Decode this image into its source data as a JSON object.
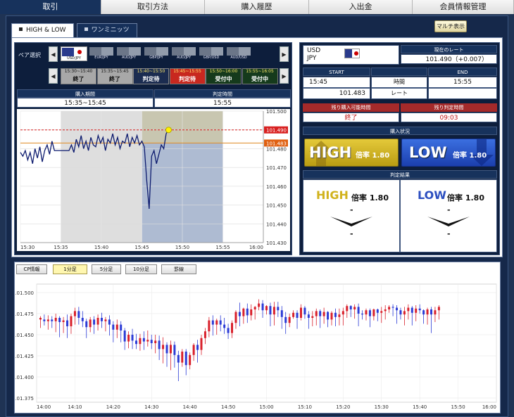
{
  "nav": {
    "tabs": [
      {
        "label": "取引",
        "active": true
      },
      {
        "label": "取引方法",
        "active": false
      },
      {
        "label": "購入履歴",
        "active": false
      },
      {
        "label": "入出金",
        "active": false
      },
      {
        "label": "会員情報管理",
        "active": false
      }
    ]
  },
  "subtabs": [
    {
      "label": "HIGH & LOW",
      "active": true
    },
    {
      "label": "ワンミニッツ",
      "active": false
    }
  ],
  "multi_button": "マルチ表示",
  "pair": {
    "label": "ペア選択",
    "items": [
      {
        "name": "USD/JPY",
        "selected": true
      },
      {
        "name": "EUR/JPY",
        "selected": false
      },
      {
        "name": "AUD/JPY",
        "selected": false
      },
      {
        "name": "GBP/JPY",
        "selected": false
      },
      {
        "name": "AUD/JPY",
        "selected": false
      },
      {
        "name": "GBP/USD",
        "selected": false
      },
      {
        "name": "AUD/USD",
        "selected": false
      }
    ]
  },
  "periods": [
    {
      "time": "15:30~15:40",
      "status": "終了",
      "state": "done"
    },
    {
      "time": "15:35~15:45",
      "status": "終了",
      "state": "done"
    },
    {
      "time": "15:40~15:50",
      "status": "判定待",
      "state": "wait"
    },
    {
      "time": "15:45~15:55",
      "status": "判定待",
      "state": "red"
    },
    {
      "time": "15:50~16:00",
      "status": "受付中",
      "state": "open"
    },
    {
      "time": "15:55~16:05",
      "status": "受付中",
      "state": "open"
    }
  ],
  "purchase_period": {
    "label": "購入期間",
    "value": "15:35~15:45"
  },
  "judgment_time": {
    "label": "判定時間",
    "value": "15:55"
  },
  "live_chart": {
    "current_rate_label": "101.490",
    "target_rate_label": "101.483",
    "yticks": [
      "101.500",
      "101.490",
      "101.480",
      "101.470",
      "101.460",
      "101.450",
      "101.440",
      "101.430"
    ],
    "xticks": [
      "15:30",
      "15:35",
      "15:40",
      "15:45",
      "15:50",
      "15:55",
      "16:00"
    ]
  },
  "chart_data": {
    "type": "line",
    "ylim": [
      101.43,
      101.5
    ],
    "xlim": [
      "15:30",
      "16:00"
    ],
    "purchase_window": [
      "15:35",
      "15:45"
    ],
    "judgment_window": [
      "15:45",
      "15:55"
    ],
    "target_rate": 101.483,
    "current_rate": 101.49,
    "x": [
      0,
      0.3,
      0.6,
      0.9,
      1.2,
      1.5,
      1.8,
      2.1,
      2.4,
      2.7,
      3.0,
      3.3,
      3.6,
      3.9,
      4.2,
      4.5,
      4.8,
      5.1,
      5.4,
      5.7,
      6.0,
      6.3,
      6.6,
      6.9,
      7.2,
      7.5,
      7.8,
      8.1,
      8.4,
      8.7,
      9.0,
      9.3,
      9.6,
      9.9,
      10.2,
      10.5,
      10.8,
      11.1,
      11.4,
      11.7,
      12.0,
      12.3,
      12.6,
      12.9,
      13.2,
      13.5,
      13.8,
      14.1,
      14.4,
      14.7,
      15.0,
      15.3,
      15.6,
      15.9,
      16.2,
      16.5,
      16.8,
      17.1,
      17.4,
      17.7,
      18.0,
      18.3
    ],
    "y": [
      101.478,
      101.476,
      101.479,
      101.474,
      101.478,
      101.472,
      101.48,
      101.475,
      101.481,
      101.473,
      101.479,
      101.482,
      101.477,
      101.484,
      101.479,
      101.479,
      101.479,
      101.479,
      101.479,
      101.479,
      101.479,
      101.482,
      101.478,
      101.485,
      101.481,
      101.487,
      101.48,
      101.484,
      101.479,
      101.486,
      101.482,
      101.481,
      101.487,
      101.483,
      101.486,
      101.479,
      101.485,
      101.483,
      101.488,
      101.482,
      101.486,
      101.48,
      101.484,
      101.483,
      101.488,
      101.481,
      101.486,
      101.483,
      101.487,
      101.482,
      101.484,
      101.481,
      101.463,
      101.448,
      101.476,
      101.479,
      101.472,
      101.477,
      101.482,
      101.48,
      101.488,
      101.49
    ]
  },
  "right": {
    "currency_top": "USD",
    "currency_bottom": "JPY",
    "current_rate_label": "現在のレート",
    "current_rate_value": "101.490（+0.007）",
    "start_label": "START",
    "end_label": "END",
    "start_value": "15:45",
    "time_label": "時間",
    "end_value": "15:55",
    "start_rate": "101.483",
    "rate_label": "レート",
    "remaining_buy_label": "残り購入可能時間",
    "remaining_buy_value": "終了",
    "remaining_judge_label": "残り判定時間",
    "remaining_judge_value": "09:03",
    "purchase_status_label": "購入状況",
    "high_label": "HIGH",
    "low_label": "LOW",
    "payout_text": "倍率 1.80",
    "result_label": "判定結果",
    "result_high": "HIGH",
    "result_low": "LOW",
    "dash": "-"
  },
  "candle_tabs": [
    {
      "label": "CP情報",
      "active": false
    },
    {
      "label": "1分足",
      "active": true
    },
    {
      "label": "5分足",
      "active": false
    },
    {
      "label": "10分足",
      "active": false
    },
    {
      "label": "罫線",
      "active": false
    }
  ],
  "candle_axis": {
    "yticks": [
      "101.500",
      "101.475",
      "101.450",
      "101.425",
      "101.400",
      "101.375"
    ],
    "xticks": [
      "14:00",
      "14:10",
      "14:20",
      "14:30",
      "14:40",
      "14:50",
      "15:00",
      "15:10",
      "15:20",
      "15:30",
      "15:40",
      "15:50",
      "16:00"
    ]
  },
  "candle_data": {
    "type": "candlestick",
    "interval": "1min",
    "ylim": [
      101.37,
      101.51
    ],
    "start_minute": 1,
    "up_color": "#d9202b",
    "down_color": "#2b3bd6",
    "candles": [
      [
        101.468,
        101.47,
        101.458,
        101.472
      ],
      [
        101.468,
        101.466,
        101.461,
        101.474
      ],
      [
        101.466,
        101.468,
        101.456,
        101.473
      ],
      [
        101.468,
        101.466,
        101.458,
        101.472
      ],
      [
        101.466,
        101.47,
        101.453,
        101.475
      ],
      [
        101.47,
        101.465,
        101.447,
        101.472
      ],
      [
        101.465,
        101.467,
        101.452,
        101.471
      ],
      [
        101.467,
        101.46,
        101.446,
        101.474
      ],
      [
        101.46,
        101.472,
        101.451,
        101.475
      ],
      [
        101.472,
        101.478,
        101.462,
        101.482
      ],
      [
        101.478,
        101.47,
        101.462,
        101.483
      ],
      [
        101.47,
        101.466,
        101.459,
        101.478
      ],
      [
        101.466,
        101.459,
        101.446,
        101.469
      ],
      [
        101.459,
        101.468,
        101.453,
        101.471
      ],
      [
        101.468,
        101.462,
        101.451,
        101.472
      ],
      [
        101.462,
        101.47,
        101.455,
        101.474
      ],
      [
        101.47,
        101.466,
        101.458,
        101.476
      ],
      [
        101.466,
        101.468,
        101.454,
        101.471
      ],
      [
        101.468,
        101.462,
        101.449,
        101.473
      ],
      [
        101.462,
        101.456,
        101.441,
        101.466
      ],
      [
        101.456,
        101.462,
        101.446,
        101.468
      ],
      [
        101.462,
        101.455,
        101.441,
        101.466
      ],
      [
        101.455,
        101.442,
        101.432,
        101.458
      ],
      [
        101.442,
        101.45,
        101.434,
        101.454
      ],
      [
        101.45,
        101.443,
        101.433,
        101.457
      ],
      [
        101.443,
        101.439,
        101.433,
        101.451
      ],
      [
        101.439,
        101.446,
        101.431,
        101.451
      ],
      [
        101.446,
        101.442,
        101.432,
        101.454
      ],
      [
        101.442,
        101.444,
        101.436,
        101.455
      ],
      [
        101.444,
        101.44,
        101.433,
        101.45
      ],
      [
        101.44,
        101.443,
        101.428,
        101.45
      ],
      [
        101.443,
        101.433,
        101.42,
        101.449
      ],
      [
        101.433,
        101.438,
        101.416,
        101.447
      ],
      [
        101.438,
        101.428,
        101.412,
        101.441
      ],
      [
        101.428,
        101.438,
        101.408,
        101.443
      ],
      [
        101.438,
        101.426,
        101.411,
        101.442
      ],
      [
        101.426,
        101.417,
        101.395,
        101.431
      ],
      [
        101.417,
        101.43,
        101.412,
        101.433
      ],
      [
        101.43,
        101.414,
        101.402,
        101.433
      ],
      [
        101.414,
        101.426,
        101.409,
        101.429
      ],
      [
        101.426,
        101.438,
        101.419,
        101.44
      ],
      [
        101.438,
        101.432,
        101.417,
        101.444
      ],
      [
        101.432,
        101.446,
        101.426,
        101.45
      ],
      [
        101.446,
        101.454,
        101.439,
        101.458
      ],
      [
        101.454,
        101.467,
        101.447,
        101.471
      ],
      [
        101.467,
        101.462,
        101.449,
        101.473
      ],
      [
        101.462,
        101.467,
        101.45,
        101.469
      ],
      [
        101.467,
        101.462,
        101.454,
        101.473
      ],
      [
        101.462,
        101.458,
        101.451,
        101.47
      ],
      [
        101.458,
        101.452,
        101.445,
        101.463
      ],
      [
        101.452,
        101.464,
        101.446,
        101.467
      ],
      [
        101.464,
        101.477,
        101.457,
        101.479
      ],
      [
        101.477,
        101.472,
        101.46,
        101.488
      ],
      [
        101.472,
        101.481,
        101.463,
        101.482
      ],
      [
        101.481,
        101.473,
        101.464,
        101.487
      ],
      [
        101.473,
        101.48,
        101.467,
        101.486
      ],
      [
        101.48,
        101.483,
        101.468,
        101.484
      ],
      [
        101.483,
        101.487,
        101.479,
        101.492
      ],
      [
        101.487,
        101.479,
        101.47,
        101.491
      ],
      [
        101.479,
        101.484,
        101.474,
        101.485
      ],
      [
        101.484,
        101.474,
        101.46,
        101.488
      ],
      [
        101.474,
        101.483,
        101.461,
        101.489
      ],
      [
        101.483,
        101.479,
        101.471,
        101.489
      ],
      [
        101.479,
        101.471,
        101.457,
        101.484
      ],
      [
        101.471,
        101.464,
        101.451,
        101.477
      ],
      [
        101.464,
        101.471,
        101.459,
        101.475
      ],
      [
        101.471,
        101.476,
        101.469,
        101.479
      ],
      [
        101.476,
        101.47,
        101.457,
        101.479
      ],
      [
        101.47,
        101.482,
        101.467,
        101.486
      ],
      [
        101.482,
        101.474,
        101.469,
        101.484
      ],
      [
        101.474,
        101.47,
        101.457,
        101.478
      ],
      [
        101.47,
        101.472,
        101.46,
        101.478
      ],
      [
        101.472,
        101.478,
        101.461,
        101.481
      ],
      [
        101.478,
        101.472,
        101.458,
        101.48
      ],
      [
        101.472,
        101.477,
        101.463,
        101.482
      ],
      [
        101.477,
        101.468,
        101.459,
        101.478
      ],
      [
        101.468,
        101.476,
        101.461,
        101.478
      ],
      [
        101.476,
        101.471,
        101.46,
        101.481
      ],
      [
        101.471,
        101.474,
        101.461,
        101.481
      ],
      [
        101.474,
        101.478,
        101.461,
        101.482
      ],
      [
        101.478,
        101.484,
        101.47,
        101.486
      ],
      [
        101.484,
        101.48,
        101.471,
        101.485
      ],
      [
        101.48,
        101.483,
        101.469,
        101.486
      ],
      [
        101.483,
        101.475,
        101.46,
        101.487
      ],
      [
        101.475,
        101.474,
        101.468,
        101.479
      ],
      [
        101.474,
        101.479,
        101.467,
        101.481
      ],
      [
        101.479,
        101.472,
        101.459,
        101.481
      ],
      [
        101.472,
        101.48,
        101.467,
        101.481
      ],
      [
        101.48,
        101.476,
        101.466,
        101.481
      ],
      [
        101.476,
        101.478,
        101.464,
        101.483
      ],
      [
        101.478,
        101.48,
        101.468,
        101.485
      ],
      [
        101.48,
        101.483,
        101.476,
        101.485
      ],
      [
        101.483,
        101.482,
        101.472,
        101.486
      ],
      [
        101.482,
        101.479,
        101.463,
        101.485
      ],
      [
        101.479,
        101.474,
        101.468,
        101.482
      ],
      [
        101.474,
        101.478,
        101.461,
        101.483
      ],
      [
        101.478,
        101.482,
        101.468,
        101.486
      ],
      [
        101.482,
        101.476,
        101.461,
        101.484
      ],
      [
        101.476,
        101.481,
        101.466,
        101.485
      ],
      [
        101.481,
        101.479,
        101.475,
        101.486
      ],
      [
        101.479,
        101.474,
        101.463,
        101.48
      ],
      [
        101.474,
        101.48,
        101.462,
        101.482
      ],
      [
        101.48,
        101.474,
        101.452,
        101.483
      ],
      [
        101.474,
        101.479,
        101.465,
        101.483
      ],
      [
        101.479,
        101.483,
        101.468,
        101.485
      ]
    ]
  }
}
